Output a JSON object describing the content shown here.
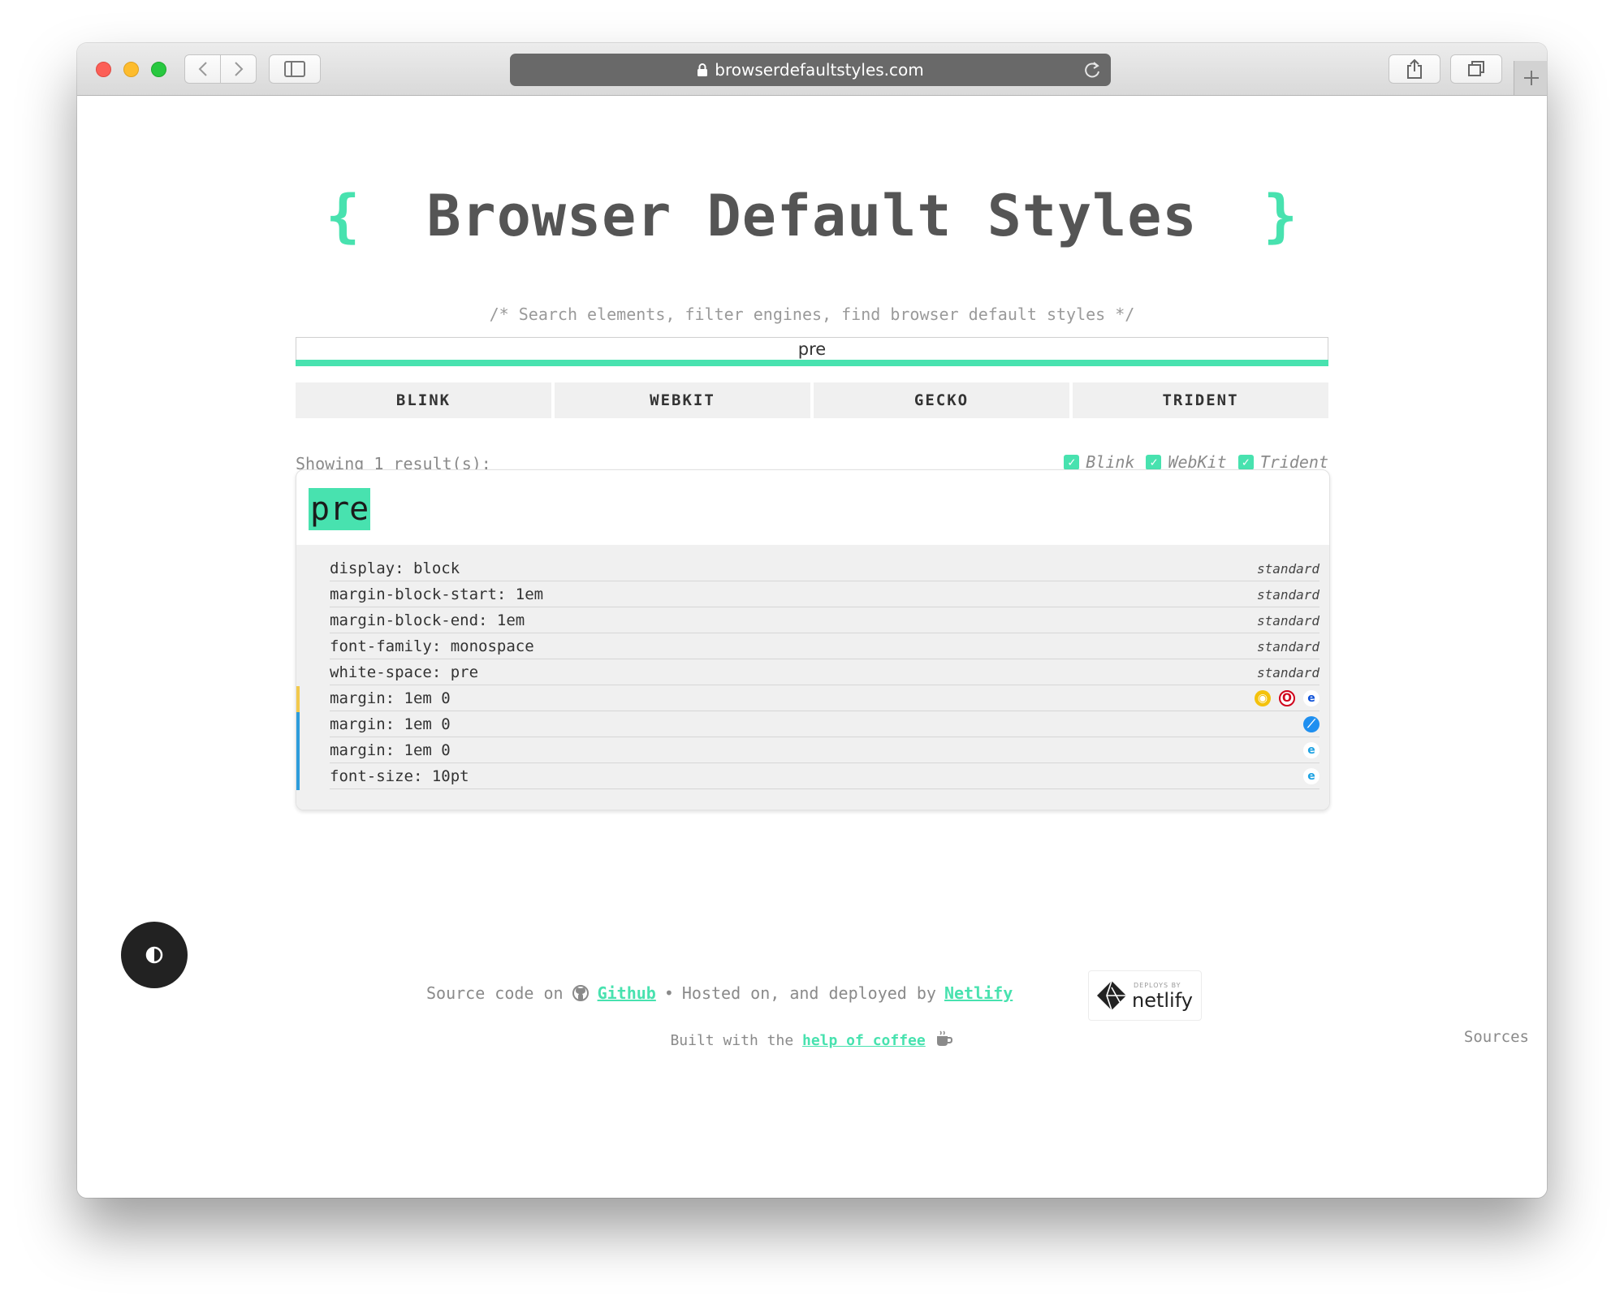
{
  "browser": {
    "url": "browserdefaultstyles.com"
  },
  "header": {
    "brace_open": "{",
    "title": "Browser Default Styles",
    "brace_close": "}",
    "subtitle": "/* Search elements, filter engines, find browser default styles */"
  },
  "search": {
    "value": "pre"
  },
  "engines": [
    "BLINK",
    "WEBKIT",
    "GECKO",
    "TRIDENT"
  ],
  "results": {
    "showing": "Showing 1 result(s):",
    "filters": [
      "Blink",
      "WebKit",
      "Trident"
    ]
  },
  "element": {
    "name": "pre",
    "properties": [
      {
        "text": "display: block",
        "tag": "standard",
        "stripe": "",
        "icons": []
      },
      {
        "text": "margin-block-start: 1em",
        "tag": "standard",
        "stripe": "",
        "icons": []
      },
      {
        "text": "margin-block-end: 1em",
        "tag": "standard",
        "stripe": "",
        "icons": []
      },
      {
        "text": "font-family: monospace",
        "tag": "standard",
        "stripe": "",
        "icons": []
      },
      {
        "text": "white-space: pre",
        "tag": "standard",
        "stripe": "",
        "icons": []
      },
      {
        "text": "margin: 1em 0",
        "tag": "",
        "stripe": "#f2c94c",
        "icons": [
          "chrome-icon",
          "opera-icon",
          "edge-icon"
        ]
      },
      {
        "text": "margin: 1em 0",
        "tag": "",
        "stripe": "#2d9cdb",
        "icons": [
          "safari-icon"
        ]
      },
      {
        "text": "margin: 1em 0",
        "tag": "",
        "stripe": "#2d9cdb",
        "icons": [
          "ie-icon"
        ]
      },
      {
        "text": "font-size: 10pt",
        "tag": "",
        "stripe": "#2d9cdb",
        "icons": [
          "ie-icon"
        ]
      }
    ]
  },
  "footer": {
    "source_prefix": "Source code on",
    "github_link": "Github",
    "bullet": "•",
    "hosted_text": "Hosted on, and deployed by",
    "netlify_link": "Netlify",
    "badge_small": "DEPLOYS BY",
    "badge_big": "netlify",
    "built_prefix": "Built with the",
    "coffee_link": "help of coffee",
    "sources": "Sources"
  },
  "colors": {
    "accent": "#48e2af",
    "text": "#555555"
  }
}
